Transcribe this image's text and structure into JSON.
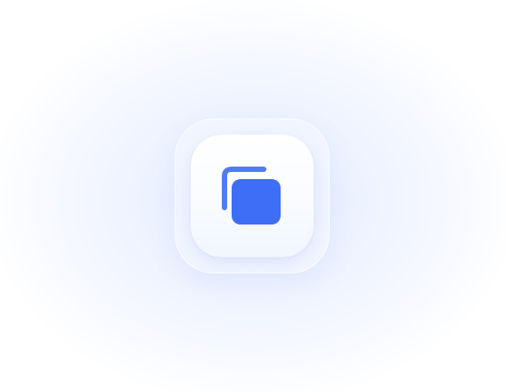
{
  "app_icon": {
    "name": "copy-icon",
    "accent_color": "#3f6ef6"
  }
}
